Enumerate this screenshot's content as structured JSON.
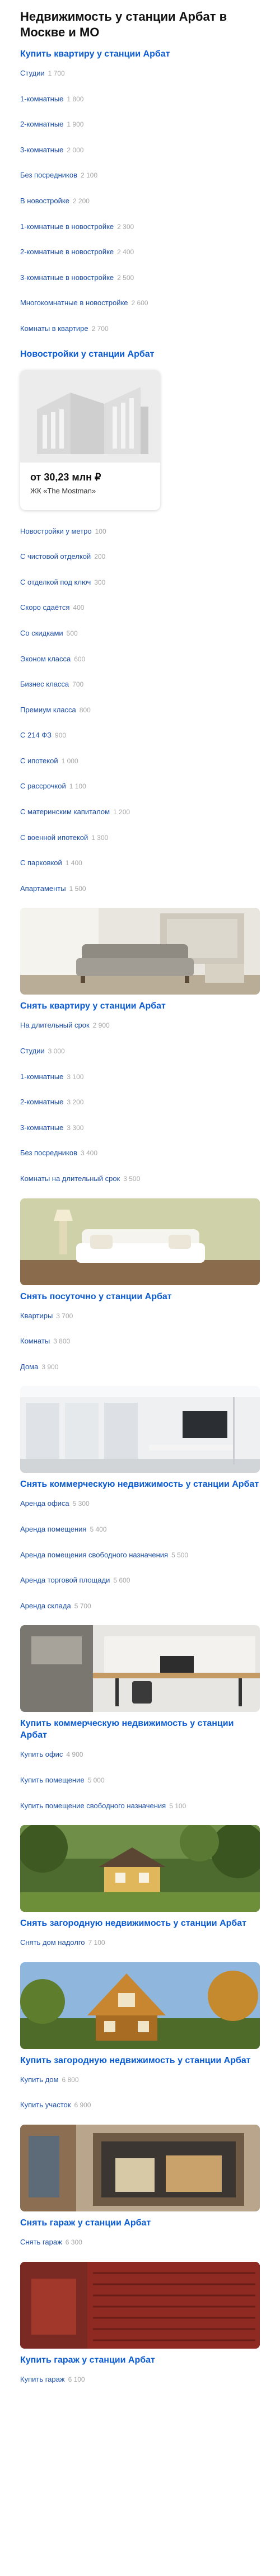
{
  "page_title": "Недвижимость у станции Арбат в Москве и МО",
  "sections": {
    "buy_flat": {
      "title": "Купить квартиру у станции Арбат",
      "items": [
        {
          "label": "Студии",
          "count": "1 700"
        },
        {
          "label": "1-комнатные",
          "count": "1 800"
        },
        {
          "label": "2-комнатные",
          "count": "1 900"
        },
        {
          "label": "3-комнатные",
          "count": "2 000"
        },
        {
          "label": "Без посредников",
          "count": "2 100"
        },
        {
          "label": "В новостройке",
          "count": "2 200"
        },
        {
          "label": "1-комнатные в новостройке",
          "count": "2 300"
        },
        {
          "label": "2-комнатные в новостройке",
          "count": "2 400"
        },
        {
          "label": "3-комнатные в новостройке",
          "count": "2 500"
        },
        {
          "label": "Многокомнатные в новостройке",
          "count": "2 600"
        },
        {
          "label": "Комнаты в квартире",
          "count": "2 700"
        }
      ]
    },
    "novostroyki": {
      "title": "Новостройки у станции Арбат",
      "card": {
        "price": "от 30,23 млн ₽",
        "name": "ЖК «The Mostman»"
      },
      "items": [
        {
          "label": "Новостройки у метро",
          "count": "100"
        },
        {
          "label": "С чистовой отделкой",
          "count": "200"
        },
        {
          "label": "С отделкой под ключ",
          "count": "300"
        },
        {
          "label": "Скоро сдаётся",
          "count": "400"
        },
        {
          "label": "Со скидками",
          "count": "500"
        },
        {
          "label": "Эконом класса",
          "count": "600"
        },
        {
          "label": "Бизнес класса",
          "count": "700"
        },
        {
          "label": "Премиум класса",
          "count": "800"
        },
        {
          "label": "С 214 ФЗ",
          "count": "900"
        },
        {
          "label": "С ипотекой",
          "count": "1 000"
        },
        {
          "label": "С рассрочкой",
          "count": "1 100"
        },
        {
          "label": "С материнским капиталом",
          "count": "1 200"
        },
        {
          "label": "С военной ипотекой",
          "count": "1 300"
        },
        {
          "label": "С парковкой",
          "count": "1 400"
        },
        {
          "label": "Апартаменты",
          "count": "1 500"
        }
      ]
    },
    "rent_flat": {
      "title": "Снять квартиру у станции Арбат",
      "items": [
        {
          "label": "На длительный срок",
          "count": "2 900"
        },
        {
          "label": "Студии",
          "count": "3 000"
        },
        {
          "label": "1-комнатные",
          "count": "3 100"
        },
        {
          "label": "2-комнатные",
          "count": "3 200"
        },
        {
          "label": "3-комнатные",
          "count": "3 300"
        },
        {
          "label": "Без посредников",
          "count": "3 400"
        },
        {
          "label": "Комнаты на длительный срок",
          "count": "3 500"
        }
      ]
    },
    "rent_daily": {
      "title": "Снять посуточно у станции Арбат",
      "items": [
        {
          "label": "Квартиры",
          "count": "3 700"
        },
        {
          "label": "Комнаты",
          "count": "3 800"
        },
        {
          "label": "Дома",
          "count": "3 900"
        }
      ]
    },
    "rent_commercial": {
      "title": "Снять коммерческую недвижимость у станции Арбат",
      "items": [
        {
          "label": "Аренда офиса",
          "count": "5 300"
        },
        {
          "label": "Аренда помещения",
          "count": "5 400"
        },
        {
          "label": "Аренда помещения свободного назначения",
          "count": "5 500"
        },
        {
          "label": "Аренда торговой площади",
          "count": "5 600"
        },
        {
          "label": "Аренда склада",
          "count": "5 700"
        }
      ]
    },
    "buy_commercial": {
      "title": "Купить коммерческую недвижимость у станции Арбат",
      "items": [
        {
          "label": "Купить офис",
          "count": "4 900"
        },
        {
          "label": "Купить помещение",
          "count": "5 000"
        },
        {
          "label": "Купить помещение свободного назначения",
          "count": "5 100"
        }
      ]
    },
    "rent_country": {
      "title": "Снять загородную недвижимость у станции Арбат",
      "items": [
        {
          "label": "Снять дом надолго",
          "count": "7 100"
        }
      ]
    },
    "buy_country": {
      "title": "Купить загородную недвижимость у станции Арбат",
      "items": [
        {
          "label": "Купить дом",
          "count": "6 800"
        },
        {
          "label": "Купить участок",
          "count": "6 900"
        }
      ]
    },
    "rent_garage": {
      "title": "Снять гараж у станции Арбат",
      "items": [
        {
          "label": "Снять гараж",
          "count": "6 300"
        }
      ]
    },
    "buy_garage": {
      "title": "Купить гараж у станции Арбат",
      "items": [
        {
          "label": "Купить гараж",
          "count": "6 100"
        }
      ]
    }
  },
  "colors": {
    "link": "#1c4fa8",
    "title_link": "#0b5bd1",
    "count": "#a6a6a6"
  }
}
